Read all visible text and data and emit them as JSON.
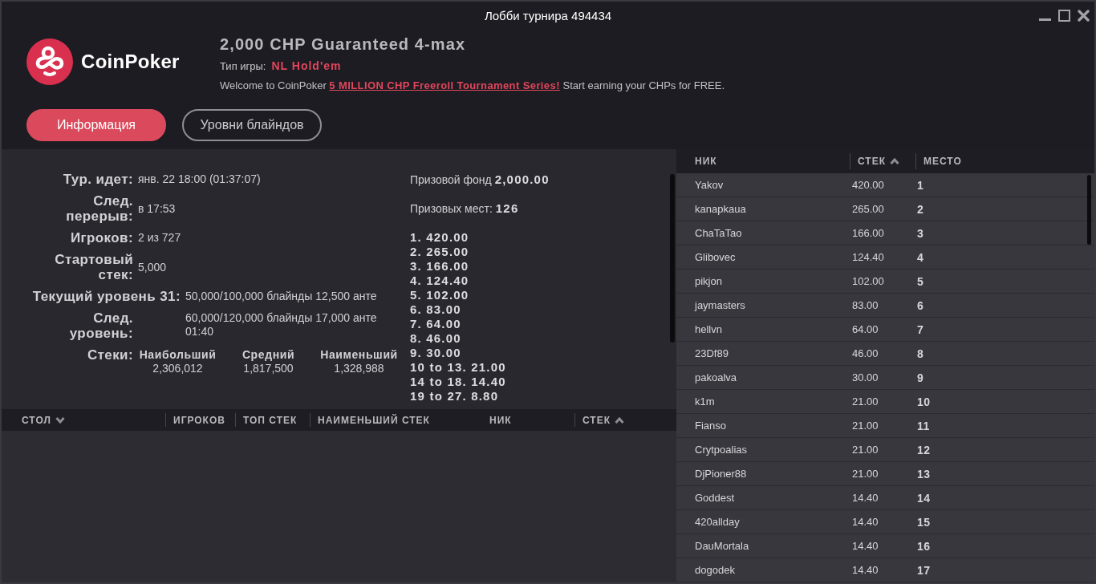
{
  "window": {
    "title": "Лобби турнира 494434"
  },
  "header": {
    "brand": "CoinPoker",
    "tournament_name": "2,000 CHP Guaranteed 4-max",
    "game_type": {
      "label": "Тип игры:",
      "value": "NL Hold'em"
    },
    "welcome": {
      "text": "Welcome to CoinPoker",
      "link": "5 MILLION CHP Freeroll Tournament Series!",
      "tail": "Start earning your CHPs for FREE."
    }
  },
  "tabs": [
    {
      "label": "Информация",
      "selected": true
    },
    {
      "label": "Уровни блайндов",
      "selected": false
    }
  ],
  "info": {
    "rows": [
      {
        "kind": "field",
        "label": "Тур. идет:",
        "value": "янв. 22 18:00 (01:37:07)"
      },
      {
        "kind": "field",
        "label": "След. перерыв:",
        "value": "в 17:53"
      },
      {
        "kind": "field",
        "label": "Игроков:",
        "value": "2 из 727"
      },
      {
        "kind": "field",
        "label": "Стартовый стек:",
        "value": "5,000"
      },
      {
        "kind": "current_level",
        "label": "Текущий уровень 31:",
        "value": "50,000/100,000 блайнды 12,500 анте"
      },
      {
        "kind": "next_level",
        "label": "След. уровень:",
        "value": "60,000/120,000 блайнды 17,000 анте",
        "time": "01:40"
      }
    ],
    "stacks": {
      "label": "Стеки:",
      "columns": [
        {
          "heading": "Наибольший",
          "value": "2,306,012"
        },
        {
          "heading": "Средний",
          "value": "1,817,500"
        },
        {
          "heading": "Наименьший",
          "value": "1,328,988"
        }
      ]
    }
  },
  "prizes": {
    "pool_label": "Призовой фонд",
    "pool": "2,000.00",
    "places_label": "Призовых мест:",
    "places": "126",
    "payouts": [
      "1. 420.00",
      "2. 265.00",
      "3. 166.00",
      "4. 124.40",
      "5. 102.00",
      "6. 83.00",
      "7. 64.00",
      "8. 46.00",
      "9. 30.00",
      "10 to 13. 21.00",
      "14 to 18. 14.40",
      "19 to 27. 8.80"
    ]
  },
  "tables_table": {
    "columns": [
      {
        "label": "СТОЛ",
        "divider": false,
        "sorted": true,
        "ascending": false
      },
      {
        "label": "ИГРОКОВ",
        "divider": true,
        "sorted": false
      },
      {
        "label": "ТОП СТЕК",
        "divider": true,
        "sorted": false
      },
      {
        "label": "НАИМЕНЬШИЙ СТЕК",
        "divider": true,
        "sorted": false
      },
      {
        "label": "НИК",
        "divider": false,
        "sorted": false
      },
      {
        "label": "СТЕК",
        "divider": true,
        "sorted": true,
        "ascending": true
      }
    ]
  },
  "players_table": {
    "columns": [
      {
        "label": "НИК",
        "divider": false,
        "sorted": false
      },
      {
        "label": "СТЕК",
        "divider": true,
        "sorted": true,
        "ascending": true
      },
      {
        "label": "МЕСТО",
        "divider": true,
        "sorted": false
      }
    ],
    "rows": [
      {
        "nick": "Yakov",
        "stack": "420.00",
        "place": "1"
      },
      {
        "nick": "kanapkaua",
        "stack": "265.00",
        "place": "2"
      },
      {
        "nick": "ChaTaTao",
        "stack": "166.00",
        "place": "3"
      },
      {
        "nick": "Glibovec",
        "stack": "124.40",
        "place": "4"
      },
      {
        "nick": "pikjon",
        "stack": "102.00",
        "place": "5"
      },
      {
        "nick": "jaymasters",
        "stack": "83.00",
        "place": "6"
      },
      {
        "nick": "hellvn",
        "stack": "64.00",
        "place": "7"
      },
      {
        "nick": "23Df89",
        "stack": "46.00",
        "place": "8"
      },
      {
        "nick": "pakoalva",
        "stack": "30.00",
        "place": "9"
      },
      {
        "nick": "k1m",
        "stack": "21.00",
        "place": "10"
      },
      {
        "nick": "Fianso",
        "stack": "21.00",
        "place": "11"
      },
      {
        "nick": "Crytpoalias",
        "stack": "21.00",
        "place": "12"
      },
      {
        "nick": "DjPioner88",
        "stack": "21.00",
        "place": "13"
      },
      {
        "nick": "Goddest",
        "stack": "14.40",
        "place": "14"
      },
      {
        "nick": "420allday",
        "stack": "14.40",
        "place": "15"
      },
      {
        "nick": "DauMortala",
        "stack": "14.40",
        "place": "16"
      },
      {
        "nick": "dogodek",
        "stack": "14.40",
        "place": "17"
      }
    ]
  }
}
